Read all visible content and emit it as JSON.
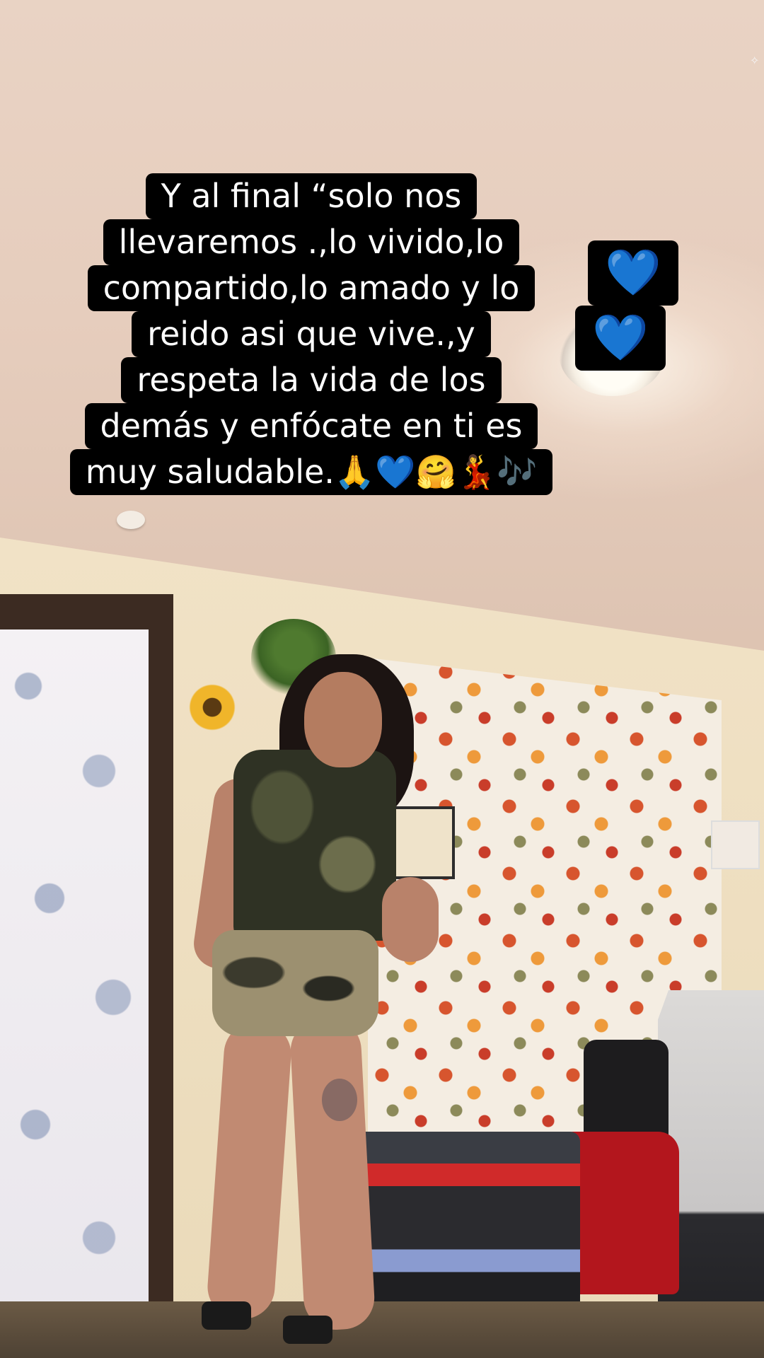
{
  "caption": {
    "lines": [
      "Y al final “solo nos",
      "llevaremos .,lo vivido,lo",
      "compartido,lo amado y lo",
      "reido asi que vive.,y",
      "respeta la vida de los",
      "demás y enfócate en ti es",
      "muy saludable.🙏💙🤗💃🎶"
    ]
  },
  "sticker": {
    "hearts": [
      "💙",
      "💙"
    ]
  },
  "colors": {
    "caption_bg": "#000000",
    "caption_text": "#ffffff",
    "heart": "#2e7cf6"
  }
}
